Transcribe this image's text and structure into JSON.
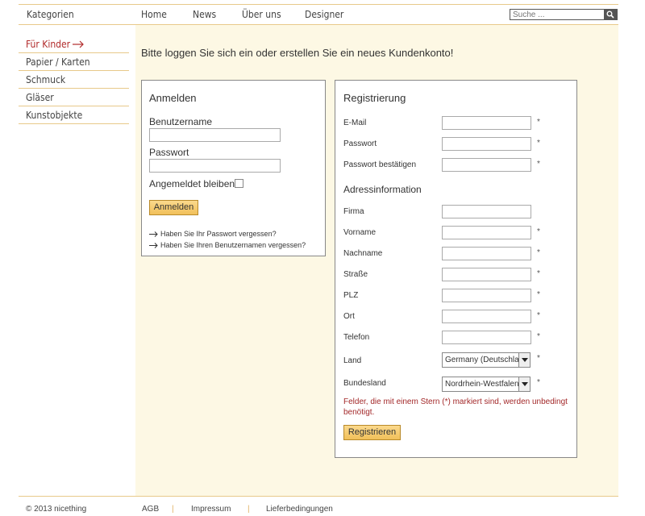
{
  "header": {
    "categories_title": "Kategorien",
    "nav": [
      "Home",
      "News",
      "Über uns",
      "Designer"
    ],
    "search_placeholder": "Suche ..."
  },
  "sidebar": {
    "items": [
      {
        "label": "Für Kinder",
        "active": true
      },
      {
        "label": "Papier / Karten",
        "active": false
      },
      {
        "label": "Schmuck",
        "active": false
      },
      {
        "label": "Gläser",
        "active": false
      },
      {
        "label": "Kunstobjekte",
        "active": false
      }
    ]
  },
  "intro": "Bitte loggen Sie sich ein oder erstellen Sie ein neues Kundenkonto!",
  "login": {
    "title": "Anmelden",
    "username_label": "Benutzername",
    "password_label": "Passwort",
    "remember_label": "Angemeldet bleiben",
    "button": "Anmelden",
    "forgot_password": "Haben Sie Ihr Passwort vergessen?",
    "forgot_username": "Haben Sie Ihren Benutzernamen vergessen?"
  },
  "register": {
    "title": "Registrierung",
    "email": "E-Mail",
    "password": "Passwort",
    "password_confirm": "Passwort bestätigen",
    "address_title": "Adressinformation",
    "company": "Firma",
    "firstname": "Vorname",
    "lastname": "Nachname",
    "street": "Straße",
    "zip": "PLZ",
    "city": "Ort",
    "phone": "Telefon",
    "country": "Land",
    "country_value": "Germany (Deutschland)",
    "state": "Bundesland",
    "state_value": "Nordrhein-Westfalen",
    "required_mark": "*",
    "note": "Felder, die mit einem Stern (*) markiert sind, werden unbedingt benötigt.",
    "button": "Registrieren"
  },
  "footer": {
    "copyright": "© 2013 nicething",
    "links": [
      "AGB",
      "Impressum",
      "Lieferbedingungen"
    ],
    "separator": "|"
  },
  "colors": {
    "accent_line": "#e8c98a",
    "cream_bg": "#fdf8e4",
    "active_red": "#b12a2a",
    "button_gold": "#f1c05a"
  }
}
